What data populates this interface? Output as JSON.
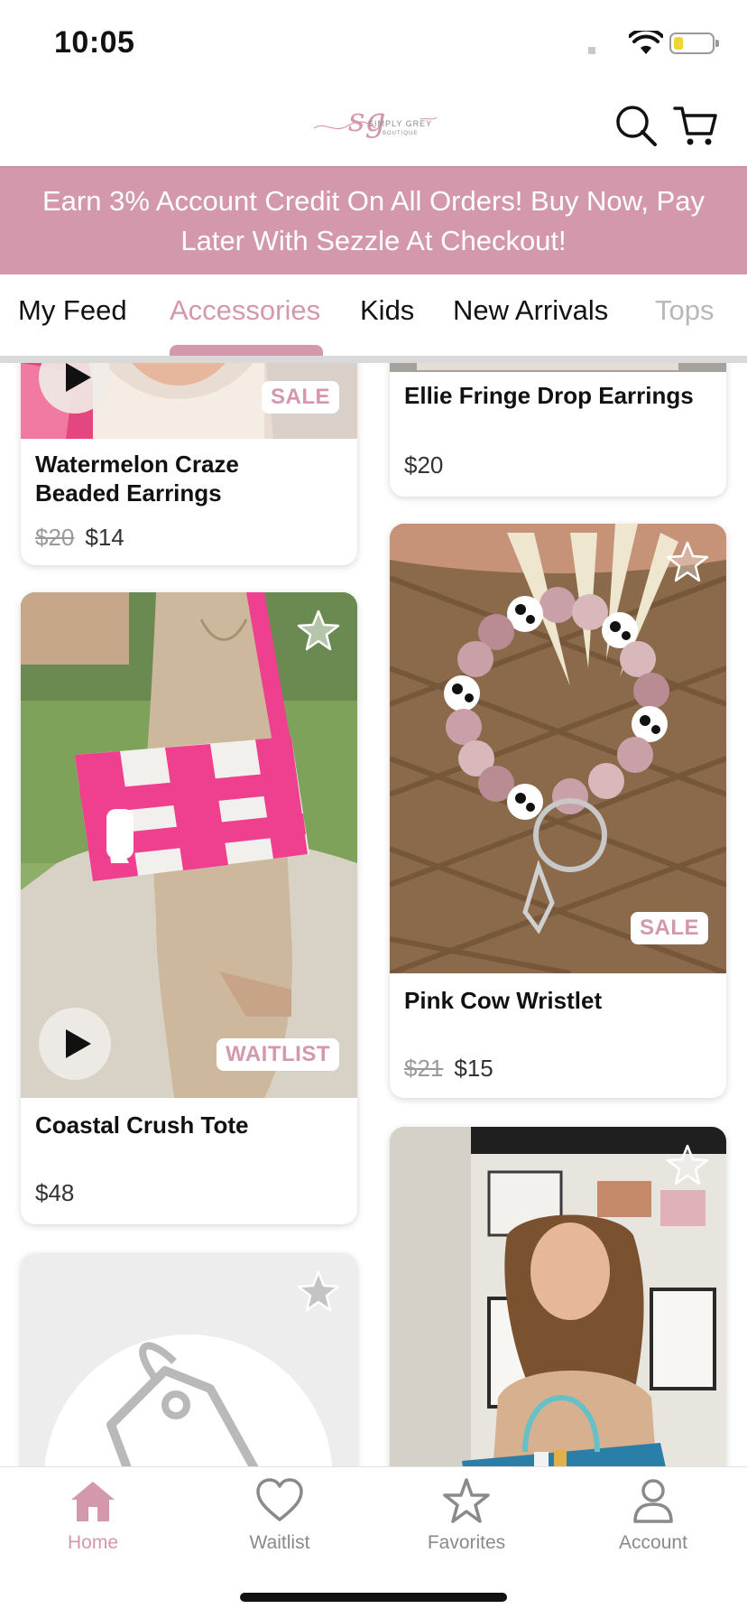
{
  "status_bar": {
    "time": "10:05",
    "battery_level": 0.25
  },
  "header": {
    "logo": {
      "mark": "sg",
      "name": "SIMPLY GREY",
      "sub": "BOUTIQUE"
    }
  },
  "promo": {
    "text": "Earn 3% Account Credit On All Orders! Buy Now, Pay Later With Sezzle At Checkout!"
  },
  "tabs": [
    {
      "label": "My Feed",
      "active": false
    },
    {
      "label": "Accessories",
      "active": true
    },
    {
      "label": "Kids",
      "active": false
    },
    {
      "label": "New Arrivals",
      "active": false
    },
    {
      "label": "Tops",
      "active": false
    }
  ],
  "products": {
    "watermelon": {
      "title_line1": "Watermelon Craze",
      "title_line2": "Beaded Earrings",
      "old_price": "$20",
      "price": "$14",
      "badge": "SALE"
    },
    "ellie": {
      "title": "Ellie Fringe Drop Earrings",
      "price": "$20"
    },
    "coastal": {
      "title": "Coastal Crush Tote",
      "price": "$48",
      "badge": "WAITLIST"
    },
    "pinkcow": {
      "title": "Pink Cow Wristlet",
      "old_price": "$21",
      "price": "$15",
      "badge": "SALE"
    }
  },
  "bottom_nav": [
    {
      "label": "Home",
      "icon": "home-icon",
      "active": true
    },
    {
      "label": "Waitlist",
      "icon": "heart-icon",
      "active": false
    },
    {
      "label": "Favorites",
      "icon": "star-icon",
      "active": false
    },
    {
      "label": "Account",
      "icon": "user-icon",
      "active": false
    }
  ],
  "colors": {
    "accent": "#d498ac",
    "text": "#111111",
    "muted": "#8a8a8a"
  }
}
